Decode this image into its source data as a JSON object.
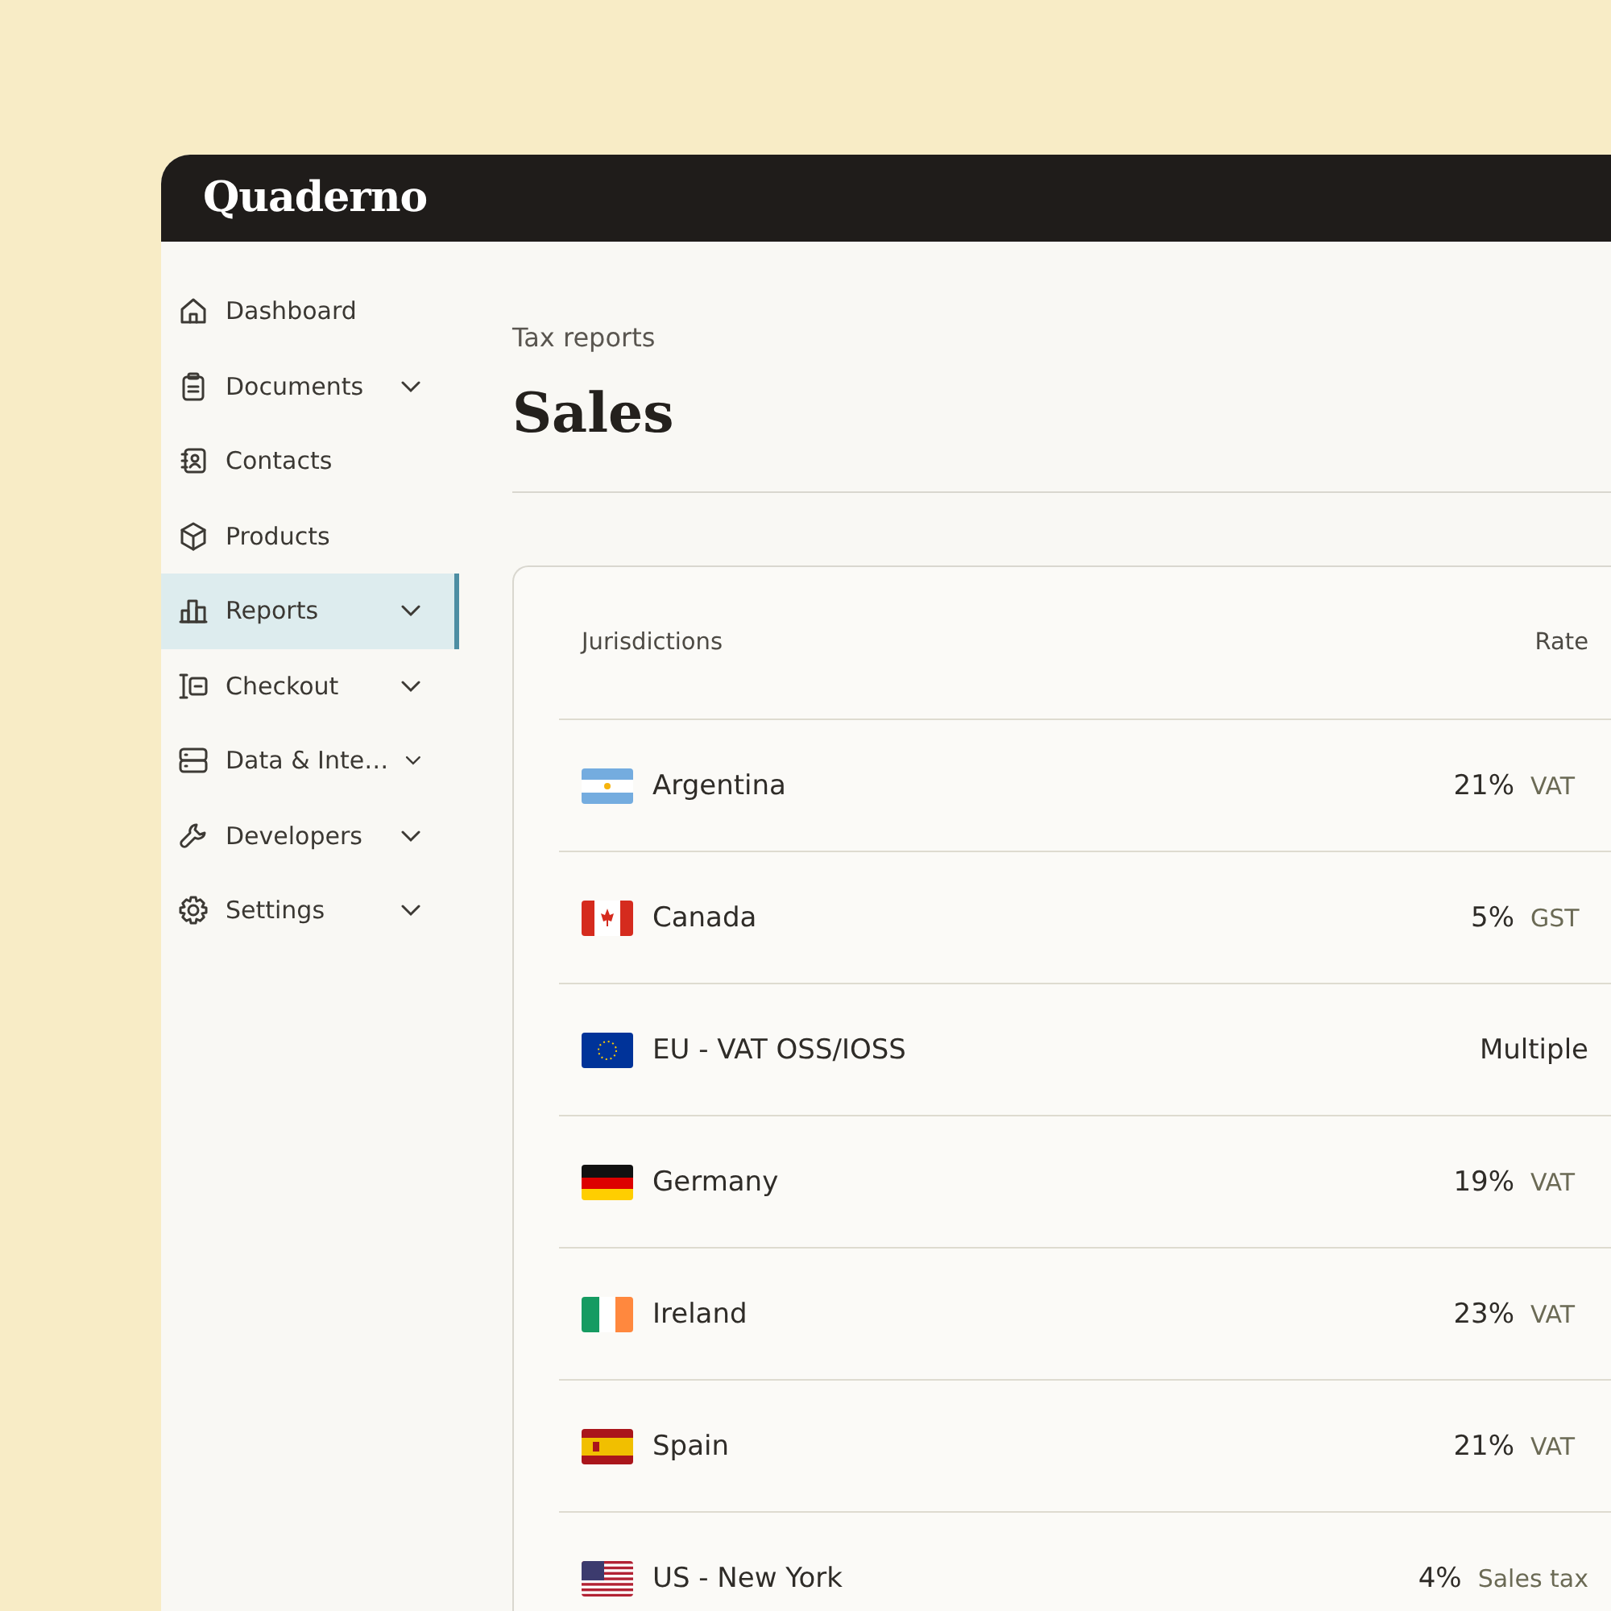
{
  "app": {
    "logo": "Quaderno"
  },
  "sidebar": {
    "items": [
      {
        "label": "Dashboard",
        "has_submenu": false,
        "selected": false
      },
      {
        "label": "Documents",
        "has_submenu": true,
        "selected": false
      },
      {
        "label": "Contacts",
        "has_submenu": false,
        "selected": false
      },
      {
        "label": "Products",
        "has_submenu": false,
        "selected": false
      },
      {
        "label": "Reports",
        "has_submenu": true,
        "selected": true
      },
      {
        "label": "Checkout",
        "has_submenu": true,
        "selected": false
      },
      {
        "label": "Data & Inte…",
        "has_submenu": true,
        "selected": false
      },
      {
        "label": "Developers",
        "has_submenu": true,
        "selected": false
      },
      {
        "label": "Settings",
        "has_submenu": true,
        "selected": false
      }
    ]
  },
  "page": {
    "breadcrumb": "Tax reports",
    "title": "Sales"
  },
  "table": {
    "columns": [
      "Jurisdictions",
      "Rate"
    ],
    "rows": [
      {
        "name": "Argentina",
        "rate": "21%",
        "tax": "VAT"
      },
      {
        "name": "Canada",
        "rate": "5%",
        "tax": "GST"
      },
      {
        "name": "EU - VAT OSS/IOSS",
        "rate": "Multiple"
      },
      {
        "name": "Germany",
        "rate": "19%",
        "tax": "VAT"
      },
      {
        "name": "Ireland",
        "rate": "23%",
        "tax": "VAT"
      },
      {
        "name": "Spain",
        "rate": "21%",
        "tax": "VAT"
      },
      {
        "name": "US - New York",
        "rate": "4%",
        "tax": "Sales tax"
      }
    ]
  }
}
